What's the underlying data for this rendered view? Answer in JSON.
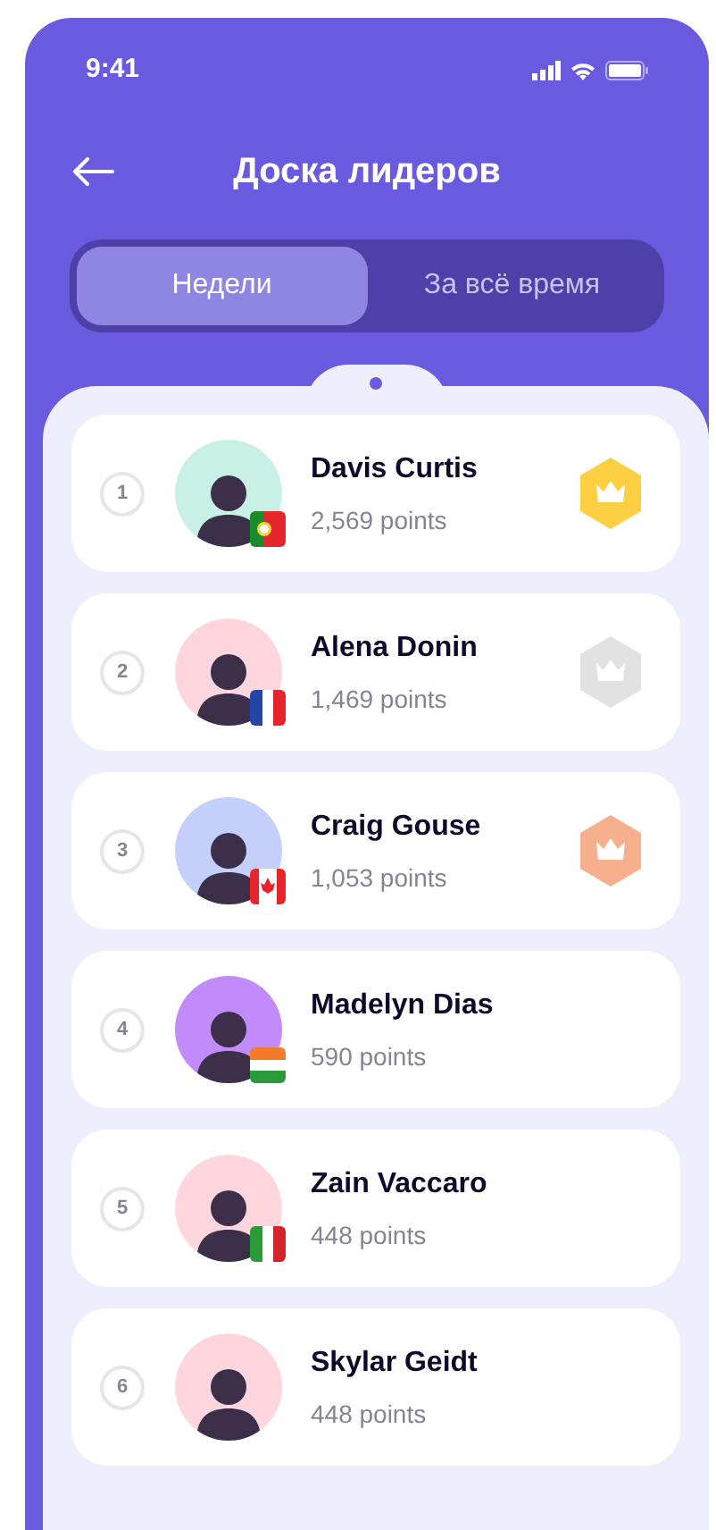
{
  "status_bar": {
    "time": "9:41"
  },
  "header": {
    "title": "Доска лидеров"
  },
  "tabs": [
    {
      "label": "Недели",
      "selected": true
    },
    {
      "label": "За всё время",
      "selected": false
    }
  ],
  "leaders": [
    {
      "rank": "1",
      "name": "Davis Curtis",
      "points": "2,569 points",
      "color": "#c9f0e4",
      "flag": {
        "kind": "pt"
      },
      "medal": {
        "kind": "gold"
      }
    },
    {
      "rank": "2",
      "name": "Alena Donin",
      "points": "1,469 points",
      "color": "#ffd6dd",
      "flag": {
        "kind": "fr"
      },
      "medal": {
        "kind": "silver"
      }
    },
    {
      "rank": "3",
      "name": "Craig Gouse",
      "points": "1,053 points",
      "color": "#c4d0fb",
      "flag": {
        "kind": "ca"
      },
      "medal": {
        "kind": "bronze"
      }
    },
    {
      "rank": "4",
      "name": "Madelyn Dias",
      "points": "590 points",
      "color": "#c28bfc",
      "flag": {
        "kind": "in"
      }
    },
    {
      "rank": "5",
      "name": "Zain Vaccaro",
      "points": "448 points",
      "color": "#ffd6dd",
      "flag": {
        "kind": "it"
      }
    },
    {
      "rank": "6",
      "name": "Skylar Geidt",
      "points": "448 points",
      "color": "#ffd6dd"
    }
  ]
}
